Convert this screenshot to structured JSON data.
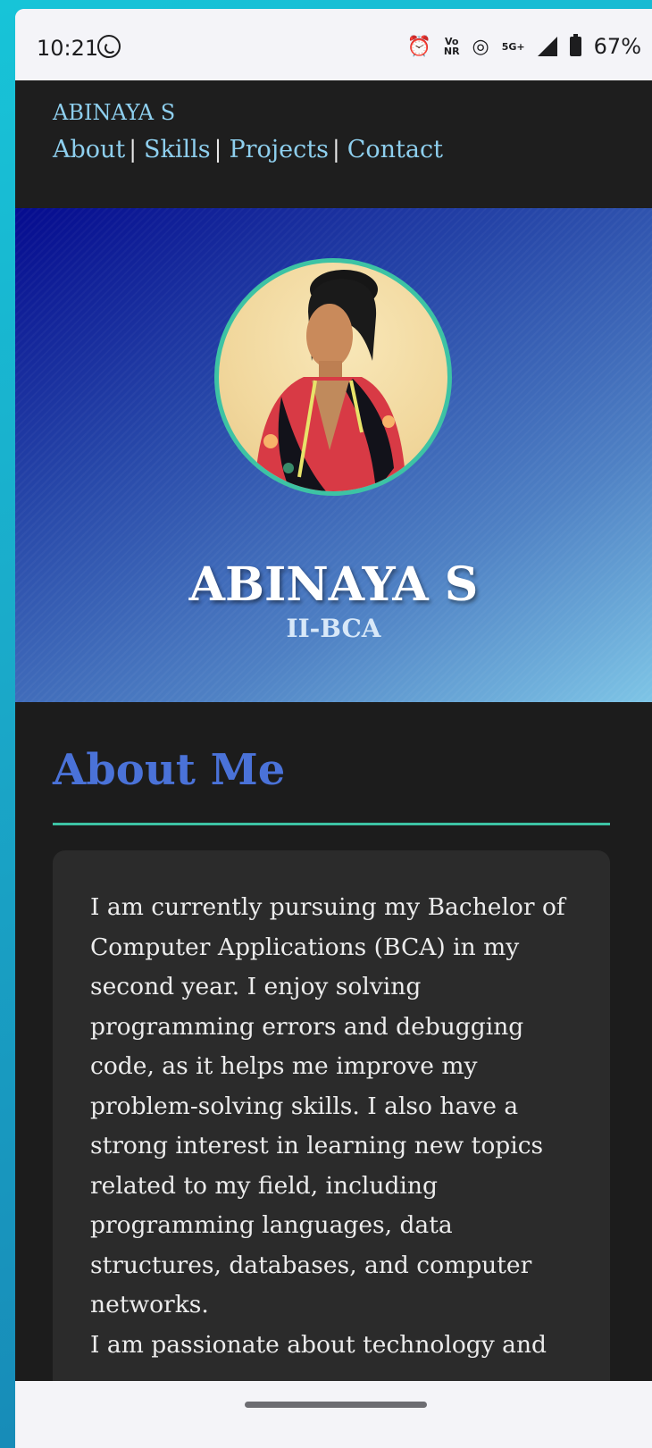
{
  "status_bar": {
    "time": "10:21",
    "network_label_top": "Vo",
    "network_label_bottom": "NR",
    "network_type": "5G+",
    "battery": "67%",
    "icons": [
      "whatsapp-icon",
      "alarm-icon",
      "volte-icon",
      "hotspot-icon",
      "signal-icon",
      "battery-icon"
    ]
  },
  "nav": {
    "brand": "ABINAYA S",
    "links": [
      "About",
      "Skills",
      "Projects",
      "Contact"
    ],
    "separator": "|"
  },
  "hero": {
    "name": "ABINAYA S",
    "subtitle": "II-BCA"
  },
  "about": {
    "title": "About Me",
    "paragraph_1": "I am currently pursuing my Bachelor of Computer Applications (BCA) in my second year. I enjoy solving programming errors and debugging code, as it helps me improve my problem-solving skills. I also have a strong interest in learning new topics related to my field, including programming languages, data structures, databases, and computer networks.",
    "paragraph_2": "I am passionate about technology and"
  },
  "colors": {
    "nav_link": "#8ecfee",
    "accent_teal": "#3dc3a4",
    "heading_blue": "#4a72d8",
    "page_dark": "#1c1c1c",
    "card_bg": "#2b2b2b"
  }
}
